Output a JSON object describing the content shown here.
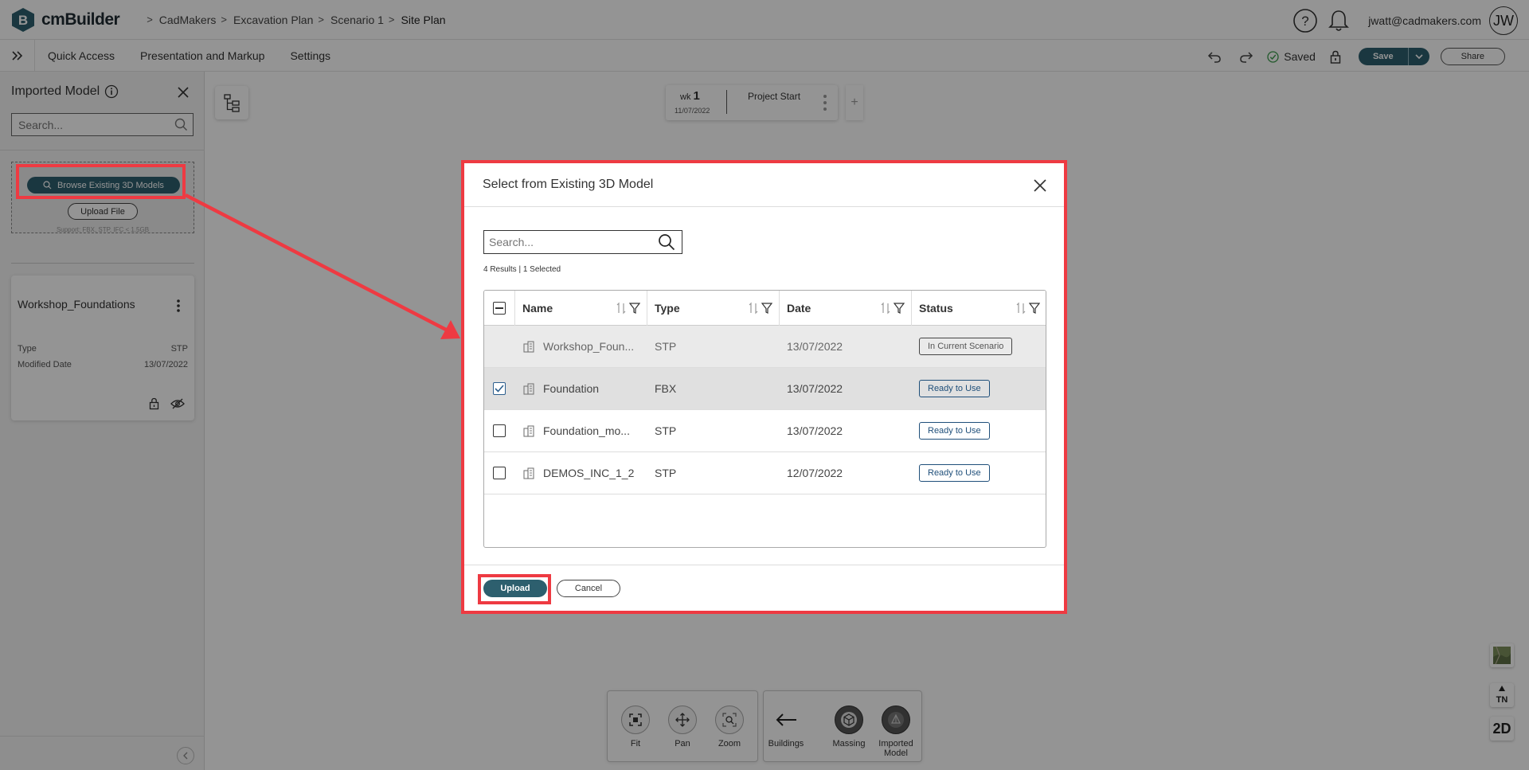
{
  "app": {
    "name": "cmBuilder",
    "breadcrumb": [
      "CadMakers",
      "Excavation Plan",
      "Scenario 1",
      "Site Plan"
    ],
    "user_email": "jwatt@cadmakers.com",
    "avatar_initials": "JW",
    "accent_color": "#2d5f6e",
    "highlight_color": "#ee3a42"
  },
  "menu": {
    "items": [
      "Quick Access",
      "Presentation and Markup",
      "Settings"
    ],
    "saved_label": "Saved",
    "save_label": "Save",
    "share_label": "Share"
  },
  "left_panel": {
    "title": "Imported Model",
    "search_placeholder": "Search...",
    "browse_label": "Browse Existing 3D Models",
    "upload_file_label": "Upload File",
    "support_text": "Support: FBX, STP, IFC < 1.5GB",
    "model_card": {
      "name": "Workshop_Foundations",
      "type_label": "Type",
      "type_value": "STP",
      "modified_label": "Modified Date",
      "modified_value": "13/07/2022"
    }
  },
  "timeline": {
    "week_label": "wk",
    "week_number": "1",
    "date": "11/07/2022",
    "event": "Project Start",
    "add_label": "+"
  },
  "toolbar": {
    "fit": "Fit",
    "pan": "Pan",
    "zoom": "Zoom",
    "buildings": "Buildings",
    "massing": "Massing",
    "imported_model": "Imported Model"
  },
  "view_controls": {
    "north_label": "TN",
    "view_mode": "2D"
  },
  "modal": {
    "title": "Select from Existing 3D Model",
    "search_placeholder": "Search...",
    "result_summary": "4 Results | 1 Selected",
    "columns": [
      "Name",
      "Type",
      "Date",
      "Status"
    ],
    "rows": [
      {
        "name": "Workshop_Foun...",
        "type": "STP",
        "date": "13/07/2022",
        "status": "In Current Scenario",
        "checked": null
      },
      {
        "name": "Foundation",
        "type": "FBX",
        "date": "13/07/2022",
        "status": "Ready to Use",
        "checked": true
      },
      {
        "name": "Foundation_mo...",
        "type": "STP",
        "date": "13/07/2022",
        "status": "Ready to Use",
        "checked": false
      },
      {
        "name": "DEMOS_INC_1_2",
        "type": "STP",
        "date": "12/07/2022",
        "status": "Ready to Use",
        "checked": false
      }
    ],
    "upload_label": "Upload",
    "cancel_label": "Cancel"
  }
}
